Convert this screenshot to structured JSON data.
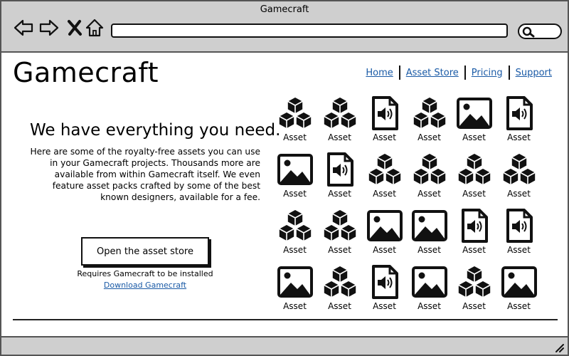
{
  "window": {
    "title": "Gamecraft"
  },
  "browser": {
    "nav": [
      "back-icon",
      "forward-icon",
      "close-icon",
      "home-icon"
    ],
    "search_icon": "search-icon"
  },
  "brand": "Gamecraft",
  "nav_links": [
    "Home",
    "Asset Store",
    "Pricing",
    "Support"
  ],
  "hero": {
    "title": "We have everything you need.",
    "text": "Here are some of the royalty-free assets you can use in your Gamecraft projects. Thousands more are available from within Gamecraft itself. We even feature asset packs crafted by some of the best known designers, available for a fee."
  },
  "cta": {
    "button": "Open the asset store",
    "requires": "Requires Gamecraft to be installed",
    "download": "Download Gamecraft"
  },
  "assets": [
    {
      "label": "Asset",
      "icon": "cubes-icon"
    },
    {
      "label": "Asset",
      "icon": "cubes-icon"
    },
    {
      "label": "Asset",
      "icon": "audio-file-icon"
    },
    {
      "label": "Asset",
      "icon": "cubes-icon"
    },
    {
      "label": "Asset",
      "icon": "image-icon"
    },
    {
      "label": "Asset",
      "icon": "audio-file-icon"
    },
    {
      "label": "Asset",
      "icon": "image-icon"
    },
    {
      "label": "Asset",
      "icon": "audio-file-icon"
    },
    {
      "label": "Asset",
      "icon": "cubes-icon"
    },
    {
      "label": "Asset",
      "icon": "cubes-icon"
    },
    {
      "label": "Asset",
      "icon": "cubes-icon"
    },
    {
      "label": "Asset",
      "icon": "cubes-icon"
    },
    {
      "label": "Asset",
      "icon": "cubes-icon"
    },
    {
      "label": "Asset",
      "icon": "cubes-icon"
    },
    {
      "label": "Asset",
      "icon": "image-icon"
    },
    {
      "label": "Asset",
      "icon": "image-icon"
    },
    {
      "label": "Asset",
      "icon": "audio-file-icon"
    },
    {
      "label": "Asset",
      "icon": "audio-file-icon"
    },
    {
      "label": "Asset",
      "icon": "image-icon"
    },
    {
      "label": "Asset",
      "icon": "cubes-icon"
    },
    {
      "label": "Asset",
      "icon": "audio-file-icon"
    },
    {
      "label": "Asset",
      "icon": "image-icon"
    },
    {
      "label": "Asset",
      "icon": "cubes-icon"
    },
    {
      "label": "Asset",
      "icon": "image-icon"
    }
  ],
  "colors": {
    "chrome": "#cfcfcf",
    "link": "#1a5aa6"
  }
}
